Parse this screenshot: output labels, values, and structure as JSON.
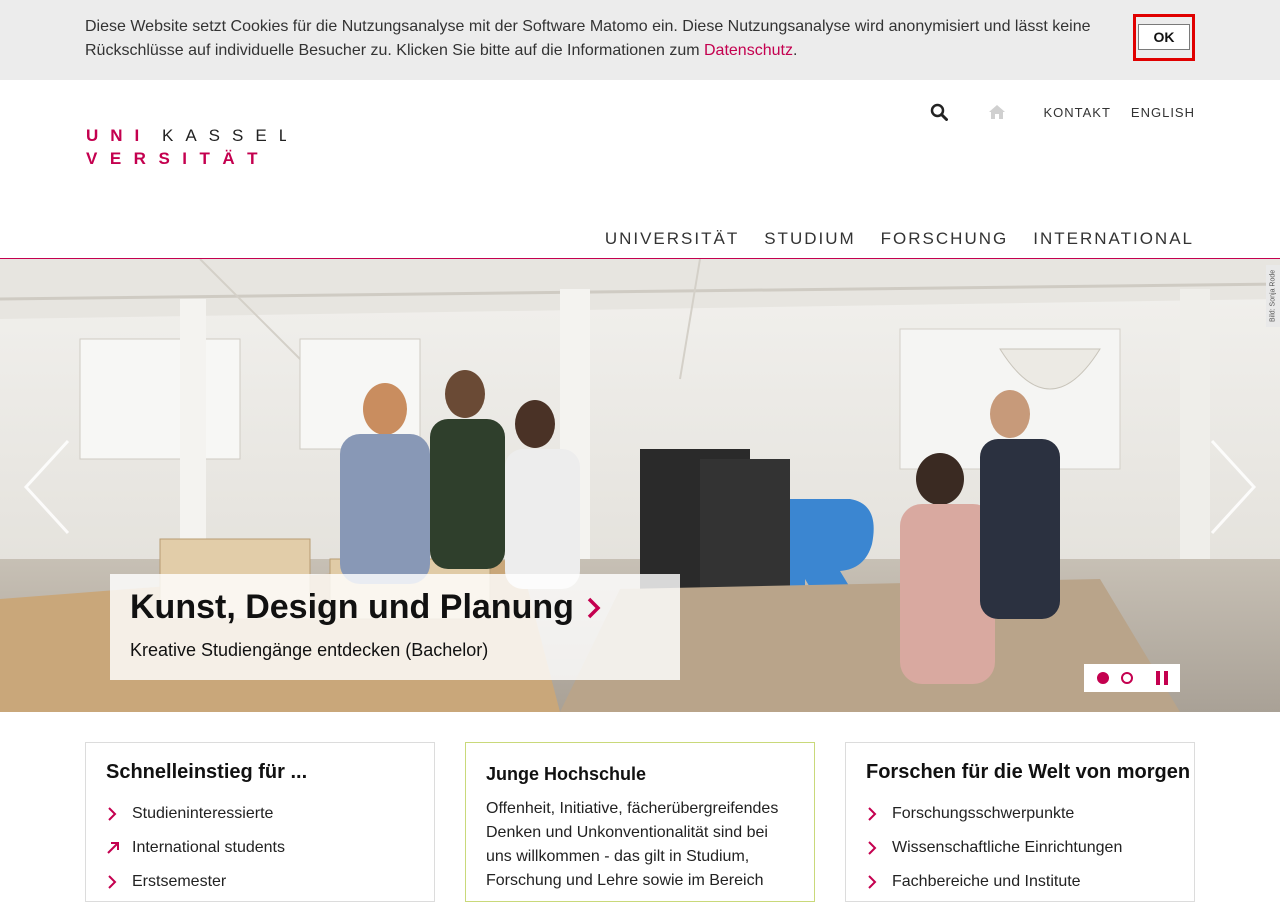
{
  "cookie": {
    "text": "Diese Website setzt Cookies für die Nutzungsanalyse mit der Software Matomo ein. Diese Nutzungsanalyse wird anonymisiert und lässt keine Rückschlüsse auf individuelle Besucher zu. Klicken Sie bitte auf die Informationen zum ",
    "link_text": "Datenschutz",
    "suffix": ".",
    "ok_label": "OK"
  },
  "brand": {
    "logo_line1": "U N I K A S S E L",
    "logo_line2": "V E R S I T Ä T",
    "accent_color": "#c4004f"
  },
  "top_nav": {
    "search_icon": "search-icon",
    "home_icon": "home-icon",
    "contact_label": "KONTAKT",
    "language_label": "ENGLISH"
  },
  "main_nav": {
    "items": [
      {
        "label": "UNIVERSITÄT"
      },
      {
        "label": "STUDIUM"
      },
      {
        "label": "FORSCHUNG"
      },
      {
        "label": "INTERNATIONAL"
      }
    ]
  },
  "hero": {
    "photo_credit": "Bild: Sonja Rode",
    "caption_title": "Kunst, Design und Planung",
    "caption_subtitle": "Kreative Studiengänge entdecken (Bachelor)",
    "prev_icon": "chevron-left-icon",
    "next_icon": "chevron-right-icon",
    "slides_total": 2,
    "active_slide": 1
  },
  "cards": [
    {
      "title": "Schnelleinstieg für ...",
      "items": [
        {
          "label": "Studieninteressierte",
          "icon": "chevron-right-icon"
        },
        {
          "label": "International students",
          "icon": "external-arrow-icon"
        },
        {
          "label": "Erstsemester",
          "icon": "chevron-right-icon"
        }
      ]
    },
    {
      "title": "Junge Hochschule",
      "text": "Offenheit, Initiative, fächerübergreifendes Denken und Unkonventionalität sind bei uns willkommen - das gilt in Studium, Forschung und Lehre sowie im Bereich"
    },
    {
      "title": "Forschen für die Welt von morgen",
      "items": [
        {
          "label": "Forschungsschwerpunkte",
          "icon": "chevron-right-icon"
        },
        {
          "label": "Wissenschaftliche Einrichtungen",
          "icon": "chevron-right-icon"
        },
        {
          "label": "Fachbereiche und Institute",
          "icon": "chevron-right-icon"
        }
      ]
    }
  ]
}
